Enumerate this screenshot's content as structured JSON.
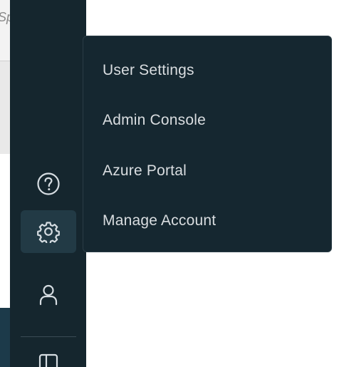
{
  "page_fragment": {
    "visible_text": "Sp"
  },
  "rail": {
    "icons": [
      "help-circle-icon",
      "gear-icon",
      "user-icon",
      "panel-layout-icon"
    ],
    "active": "gear-icon"
  },
  "settings_menu": {
    "items": [
      {
        "label": "User Settings"
      },
      {
        "label": "Admin Console"
      },
      {
        "label": "Azure Portal"
      },
      {
        "label": "Manage Account"
      }
    ]
  },
  "colors": {
    "rail_background": "#15262e",
    "rail_active": "#223a45",
    "menu_background": "#152730",
    "menu_text": "#d9dde0",
    "icon_stroke": "#d6dde2"
  }
}
